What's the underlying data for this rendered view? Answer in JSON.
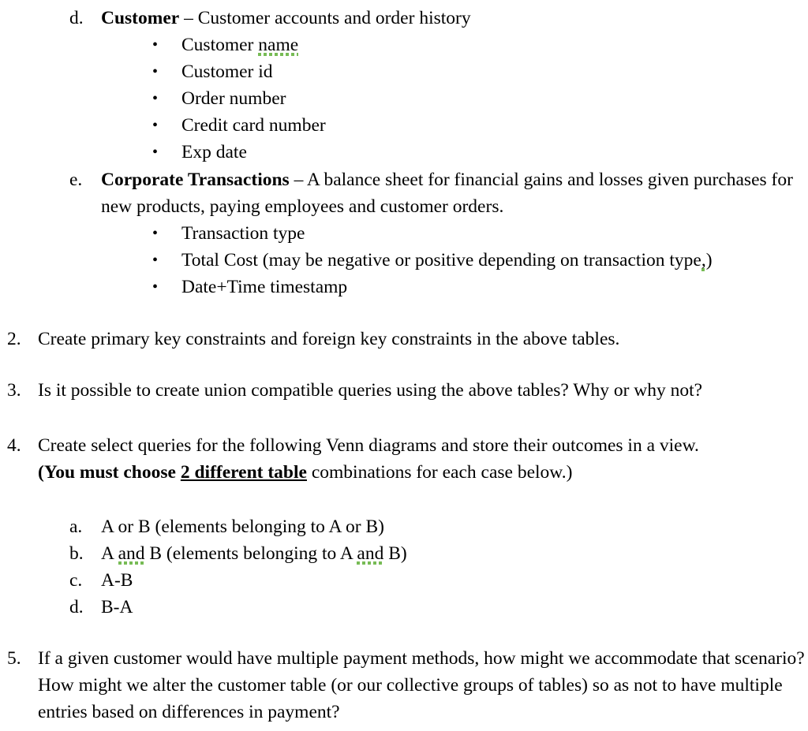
{
  "document": {
    "type": "assignment-worksheet",
    "background_color": "#ffffff",
    "text_color": "#000000",
    "spellcheck_squiggle_color": "#77bb55"
  },
  "table_descriptions": [
    {
      "marker": "d.",
      "title": "Customer",
      "dash": " – ",
      "description": "Customer accounts and order history",
      "fields": [
        {
          "text": "Customer ",
          "squiggle_word": "name",
          "bullet": "•"
        },
        {
          "text": "Customer id",
          "squiggle_word": "",
          "bullet": "•"
        },
        {
          "text": "Order number",
          "squiggle_word": "",
          "bullet": "•"
        },
        {
          "text": "Credit card number",
          "squiggle_word": "",
          "bullet": "•"
        },
        {
          "text": "Exp date",
          "squiggle_word": "",
          "bullet": "•"
        }
      ]
    },
    {
      "marker": "e.",
      "title": "Corporate Transactions",
      "dash": " – ",
      "description": "A balance sheet for financial gains and losses given purchases for new products, paying employees and customer orders.",
      "fields": [
        {
          "text": "Transaction type",
          "squiggle_word": "",
          "bullet": "•"
        },
        {
          "text": "Total Cost (may be negative or positive depending on transaction type",
          "squiggle_word": ",",
          "trailing": ")",
          "bullet": "•"
        },
        {
          "text": "Date+Time timestamp",
          "squiggle_word": "",
          "bullet": "•"
        }
      ]
    }
  ],
  "questions": [
    {
      "marker": "2.",
      "text": "Create primary key constraints and foreign key constraints in the above tables."
    },
    {
      "marker": "3.",
      "text": "Is it possible to create union compatible queries using the above tables? Why or why not?"
    },
    {
      "marker": "4.",
      "line1": "Create select queries for the following Venn diagrams and store their outcomes in a view.",
      "line2_bold_prefix": "(You must choose ",
      "line2_bold_underline": "2 different table",
      "line2_plain_suffix": " combinations for each case below.)",
      "subitems": [
        {
          "marker": "a.",
          "pre": "A or B (elements belonging to A or B)",
          "squiggle1": "",
          "mid": "",
          "squiggle2": "",
          "post": ""
        },
        {
          "marker": "b.",
          "pre": "A ",
          "squiggle1": "and",
          "mid": " B (elements belonging to A ",
          "squiggle2": "and",
          "post": " B)"
        },
        {
          "marker": "c.",
          "pre": "A-B",
          "squiggle1": "",
          "mid": "",
          "squiggle2": "",
          "post": ""
        },
        {
          "marker": "d.",
          "pre": "B-A",
          "squiggle1": "",
          "mid": "",
          "squiggle2": "",
          "post": ""
        }
      ]
    },
    {
      "marker": "5.",
      "text": "If a given customer would have multiple payment methods, how might we accommodate that scenario? How might we alter the customer table (or our collective groups of tables) so as not to have multiple entries based on differences in payment?"
    }
  ]
}
